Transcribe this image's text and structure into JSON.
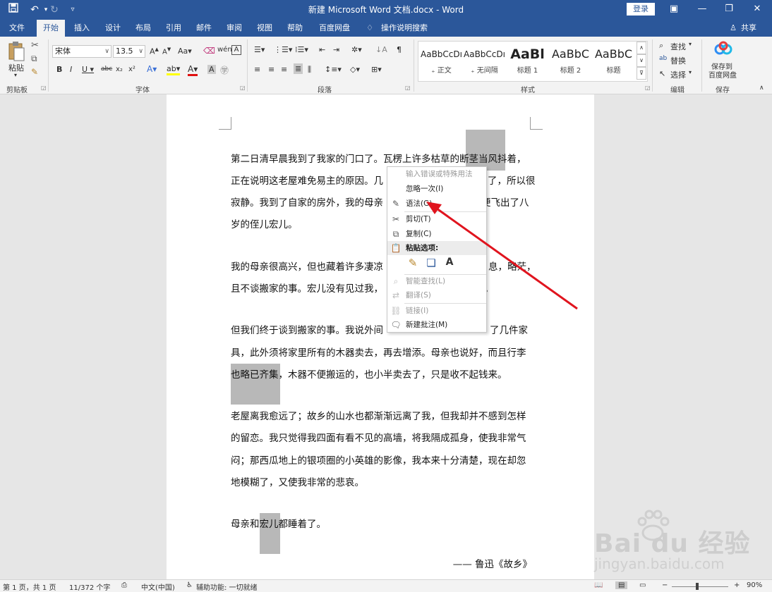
{
  "titlebar": {
    "title": "新建 Microsoft Word 文档.docx  -  Word",
    "login": "登录",
    "save_icon": "save-icon",
    "undo_icon": "undo-icon",
    "redo_icon": "redo-icon"
  },
  "tabs": [
    "文件",
    "开始",
    "插入",
    "设计",
    "布局",
    "引用",
    "邮件",
    "审阅",
    "视图",
    "帮助",
    "百度网盘",
    "操作说明搜索"
  ],
  "share": "共享",
  "ribbon": {
    "paste": "粘贴",
    "clipboard_label": "剪贴板",
    "font_name": "宋体",
    "font_size": "13.5",
    "font_label": "字体",
    "paragraph_label": "段落",
    "styles_label": "样式",
    "styles": [
      {
        "sample": "AaBbCcDı",
        "name": "₊ 正文"
      },
      {
        "sample": "AaBbCcDı",
        "name": "₊ 无间隔"
      },
      {
        "sample": "AaBl",
        "name": "标题 1"
      },
      {
        "sample": "AaBbC",
        "name": "标题 2"
      },
      {
        "sample": "AaBbC",
        "name": "标题"
      }
    ],
    "find": "查找",
    "replace": "替换",
    "select": "选择",
    "edit_label": "编辑",
    "baidu_save": "保存到",
    "baidu_save2": "百度网盘",
    "save_label": "保存"
  },
  "document": {
    "lines": [
      "第二日清早晨我到了我家的门口了。瓦楞上许多枯草的断茎当风抖着，",
      "正在说明这老屋难免易主的原因。几",
      "了，所以很",
      "寂静。我到了自家的房外，我的母亲",
      "便飞出了八",
      "岁的侄儿宏儿。",
      "我的母亲很高兴，但也藏着许多凄凉",
      "息，略茫，",
      "且不谈搬家的事。宏儿没有见过我，",
      "。",
      "但我们终于谈到搬家的事。我说外间",
      "了几件家",
      "具，此外须将家里所有的木器卖去，再去增添。母亲也说好，而且行李",
      "也略已齐集，木器不便搬运的，也小半卖去了，只是收不起钱来。",
      "老屋离我愈远了；故乡的山水也都渐渐远离了我，但我却并不感到怎样",
      "的留恋。我只觉得我四面有看不见的高墙，将我隔成孤身，使我非常气",
      "闷；那西瓜地上的银项圈的小英雄的影像，我本来十分清楚，现在却忽",
      "地模糊了，又使我非常的悲哀。",
      "母亲和宏儿都睡着了。",
      "—— 鲁迅《故乡》"
    ]
  },
  "context_menu": {
    "items": [
      {
        "label": "输入错误或特殊用法",
        "enabled": false
      },
      {
        "label": "忽略一次(I)",
        "enabled": true
      },
      {
        "label": "语法(G)",
        "enabled": true
      },
      {
        "label": "剪切(T)",
        "enabled": true
      },
      {
        "label": "复制(C)",
        "enabled": true
      },
      {
        "label": "粘贴选项:",
        "enabled": true
      },
      {
        "label": "智能查找(L)",
        "enabled": false
      },
      {
        "label": "翻译(S)",
        "enabled": false
      },
      {
        "label": "链接(I)",
        "enabled": false
      },
      {
        "label": "新建批注(M)",
        "enabled": true
      }
    ]
  },
  "status": {
    "page": "第 1 页，共 1 页",
    "words": "11/372 个字",
    "lang": "中文(中国)",
    "accessibility": "辅助功能: 一切就绪",
    "zoom": "90%"
  },
  "watermark": {
    "brand": "Bai du 经验",
    "url": "jingyan.baidu.com"
  },
  "colors": {
    "accent": "#2b579a",
    "arrow": "#e0141e"
  }
}
